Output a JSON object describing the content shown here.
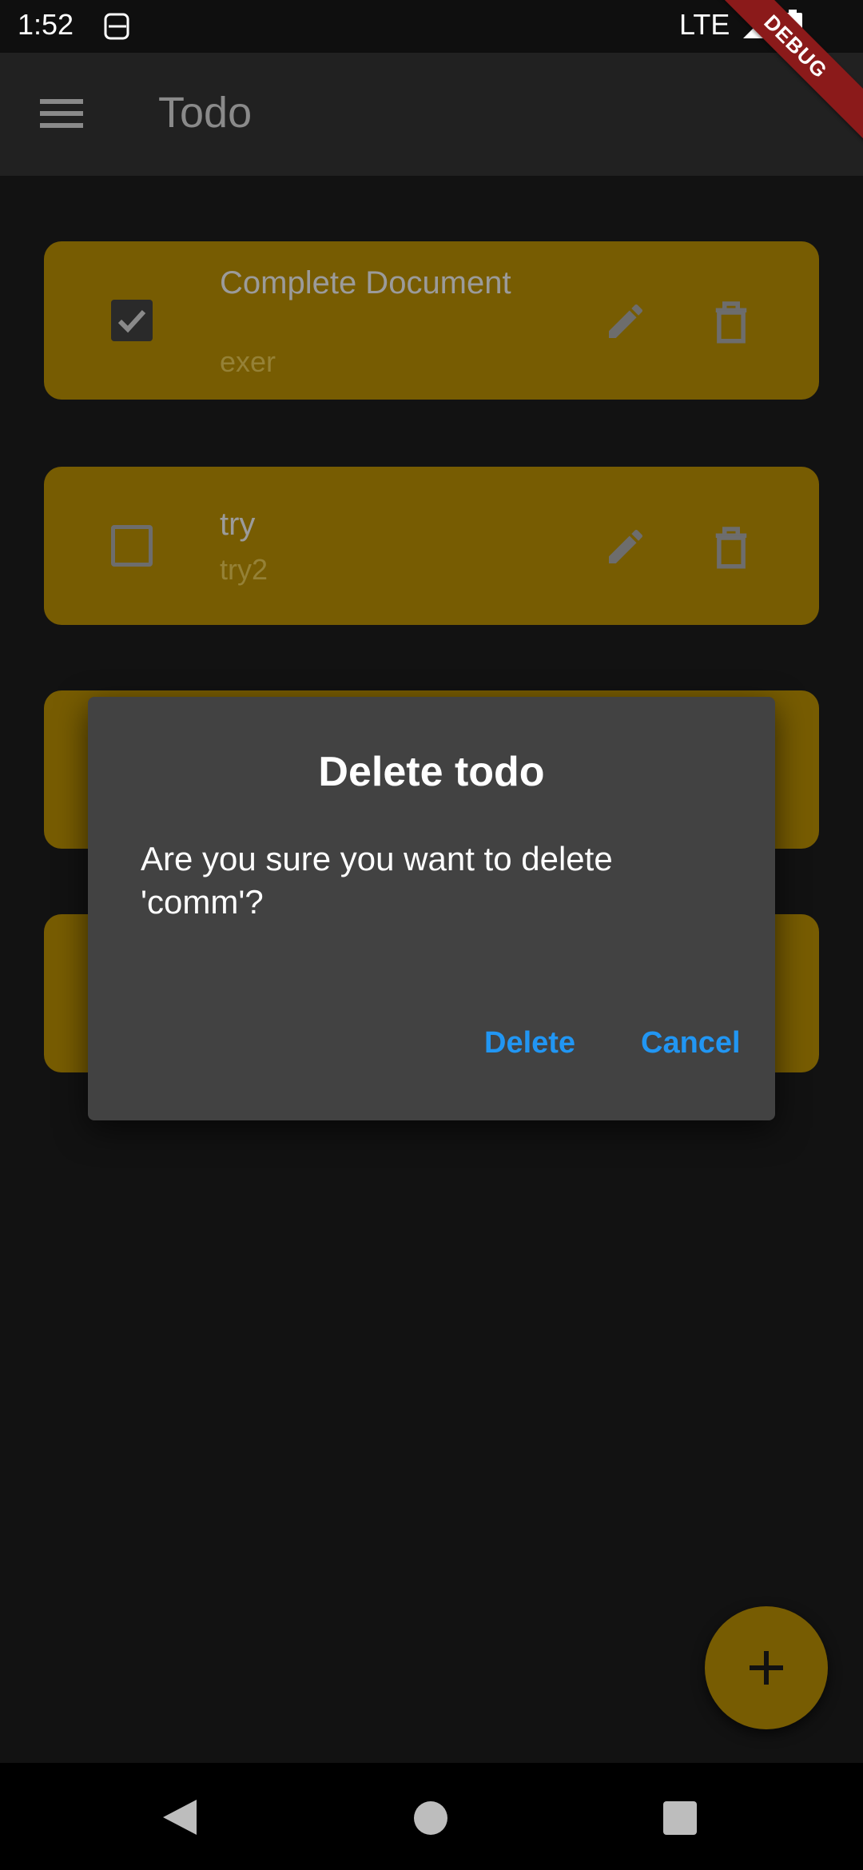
{
  "status_bar": {
    "time": "1:52",
    "network": "LTE",
    "icons": [
      "sim-icon",
      "signal-icon",
      "battery-icon"
    ]
  },
  "debug_banner": {
    "label": "DEBUG"
  },
  "app_bar": {
    "title": "Todo",
    "menu_icon": "menu-icon"
  },
  "todos": [
    {
      "title": "Complete Document",
      "subtitle": "exer",
      "checked": true
    },
    {
      "title": "try",
      "subtitle": "try2",
      "checked": false
    },
    {
      "title": "",
      "subtitle": "",
      "checked": false
    },
    {
      "title": "",
      "subtitle": "",
      "checked": false
    }
  ],
  "dialog": {
    "title": "Delete todo",
    "message": "Are you sure you want to delete 'comm'?",
    "delete_label": "Delete",
    "cancel_label": "Cancel"
  },
  "fab": {
    "icon": "add-icon"
  },
  "nav_bar": {
    "icons": [
      "back-icon",
      "home-icon",
      "recents-icon"
    ]
  },
  "colors": {
    "background": "#121212",
    "app_bar": "#212121",
    "card": "#775c02",
    "dialog": "#424242",
    "accent": "#2196f3",
    "debug_banner": "#8b1a1a"
  }
}
